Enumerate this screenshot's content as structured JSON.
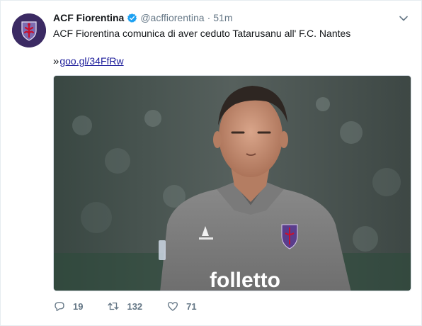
{
  "tweet": {
    "author_name": "ACF Fiorentina",
    "handle": "@acffiorentina",
    "separator": "·",
    "time": "51m",
    "text": "ACF Fiorentina comunica di aver ceduto Tatarusanu all' F.C. Nantes",
    "link_prefix": "»",
    "link": "goo.gl/34FfRw",
    "media": {
      "jersey_sponsor": "folletto",
      "kit_brand": "le coq sportif"
    }
  },
  "actions": {
    "reply_count": "19",
    "retweet_count": "132",
    "like_count": "71"
  },
  "colors": {
    "verified": "#1da1f2",
    "link": "#1b1b9a",
    "muted": "#657786",
    "fiorentina_purple": "#3b2a63"
  },
  "icons": [
    "fiorentina-logo-icon",
    "verified-icon",
    "caret-down-icon",
    "reply-icon",
    "retweet-icon",
    "like-icon"
  ]
}
